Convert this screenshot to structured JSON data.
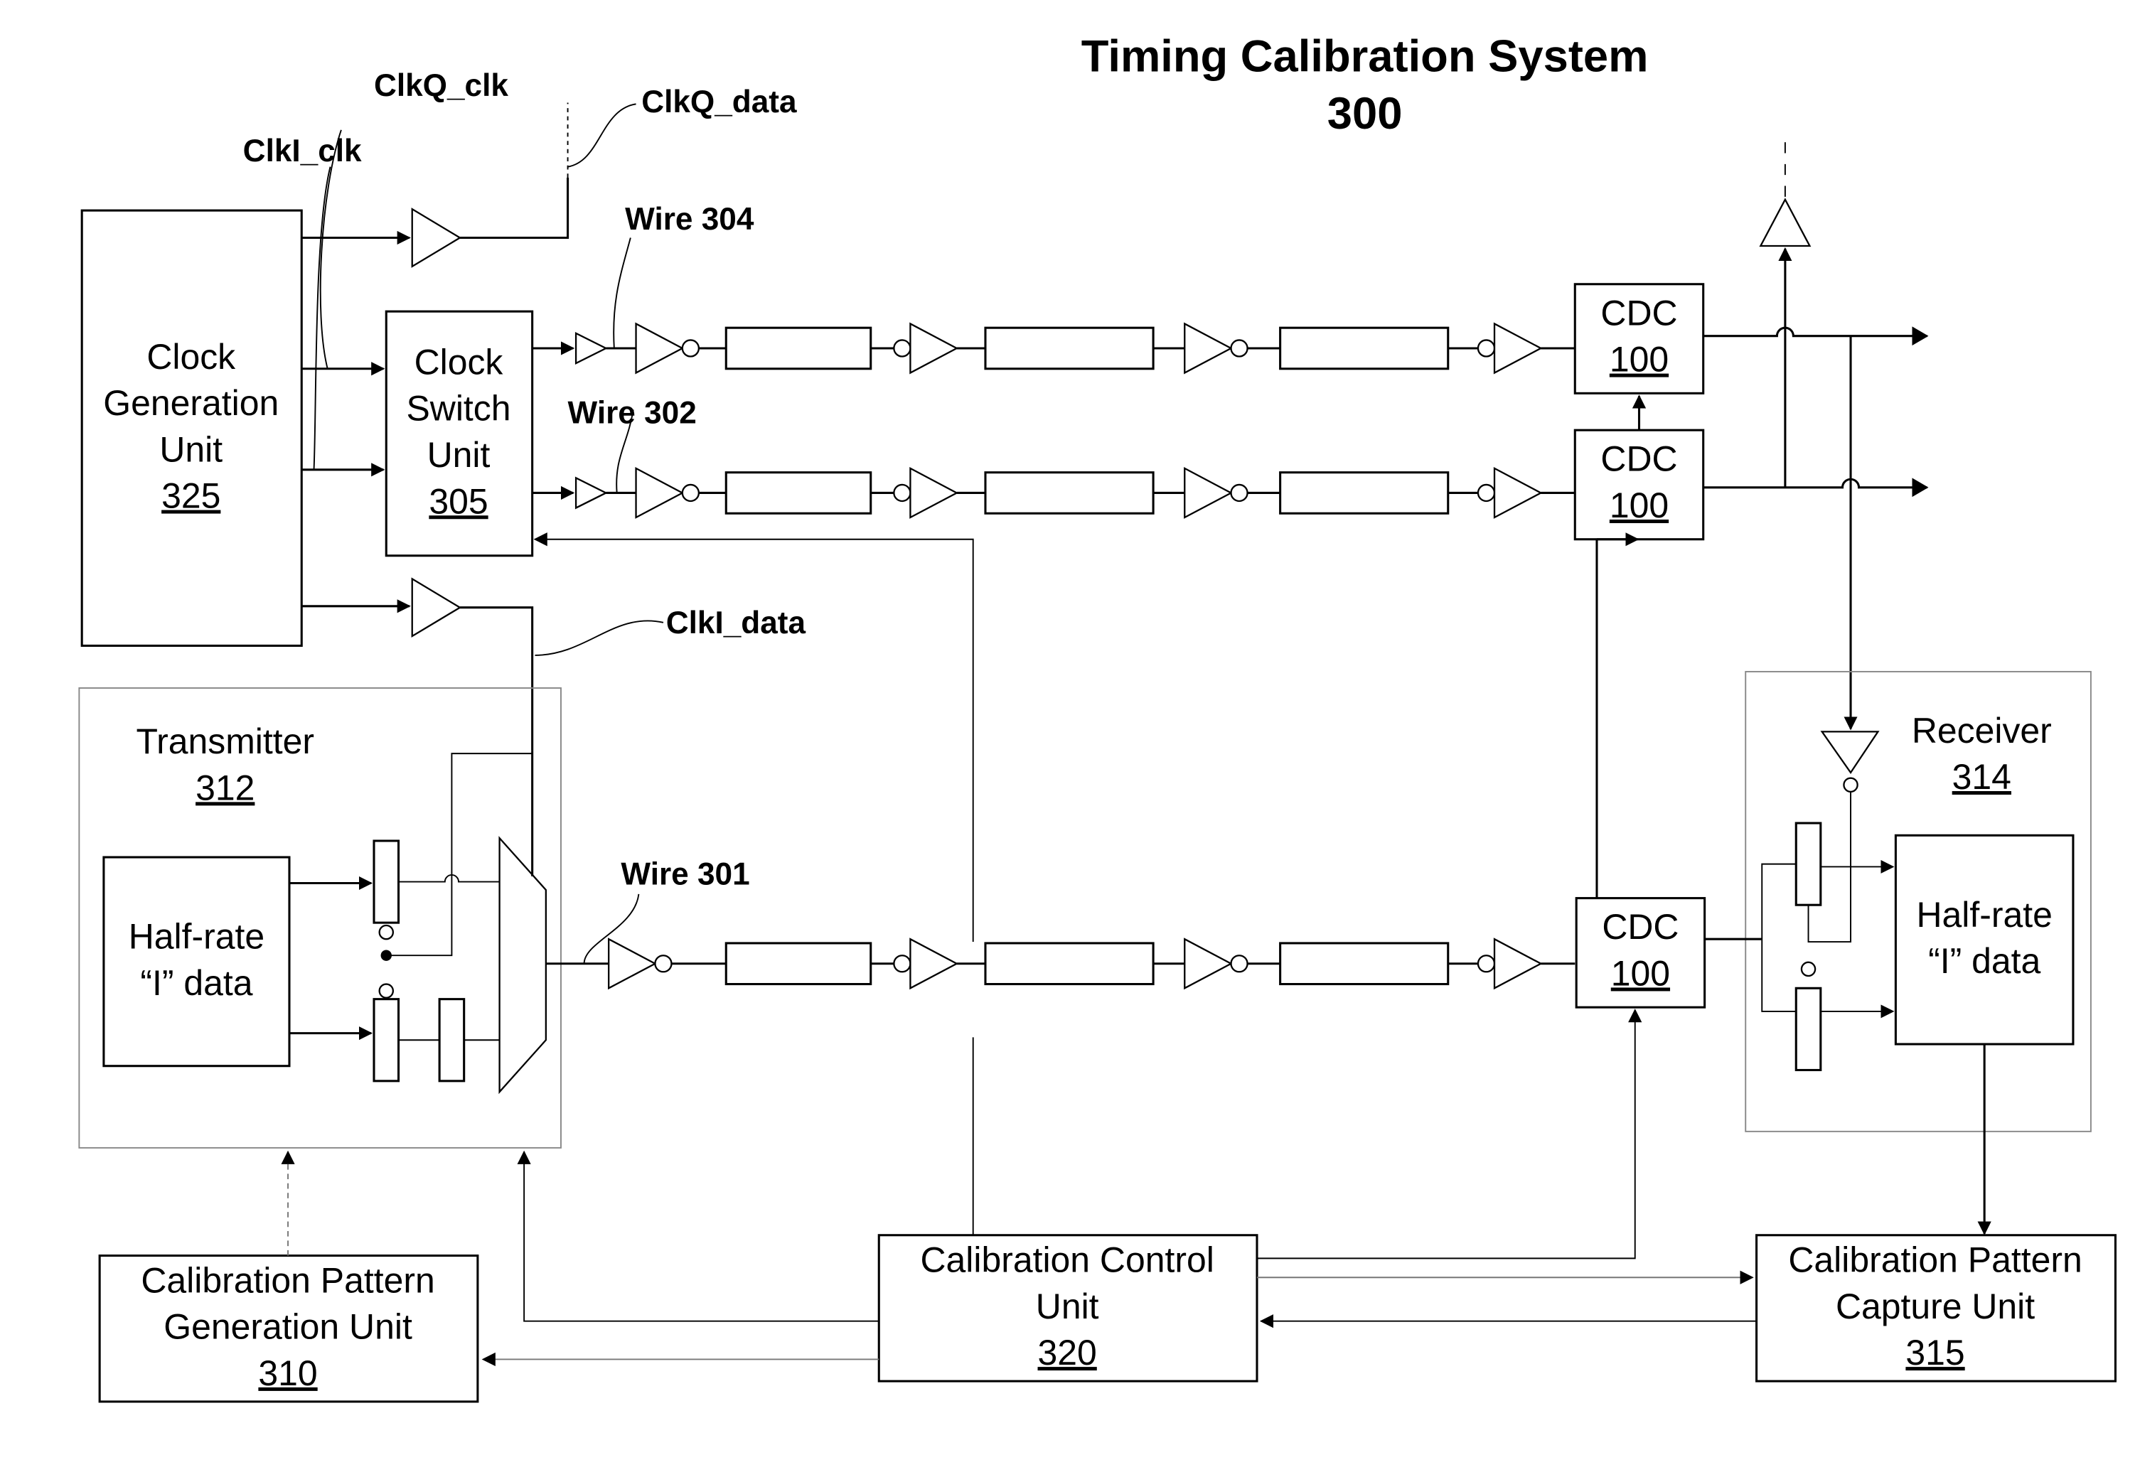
{
  "title": {
    "line1": "Timing Calibration System",
    "line2": "300"
  },
  "signals": {
    "clkq_clk": "ClkQ_clk",
    "clki_clk": "ClkI_clk",
    "clkq_data": "ClkQ_data",
    "clki_data": "ClkI_data"
  },
  "wires": {
    "w304": "Wire 304",
    "w302": "Wire 302",
    "w301": "Wire 301"
  },
  "blocks": {
    "clock_gen": {
      "lines": [
        "Clock",
        "Generation",
        "Unit"
      ],
      "ref": "325"
    },
    "clock_switch": {
      "lines": [
        "Clock",
        "Switch",
        "Unit"
      ],
      "ref": "305"
    },
    "transmitter": {
      "lines": [
        "Transmitter"
      ],
      "ref": "312"
    },
    "tx_data": {
      "lines": [
        "Half-rate",
        "“I” data"
      ]
    },
    "receiver": {
      "lines": [
        "Receiver"
      ],
      "ref": "314"
    },
    "rx_data": {
      "lines": [
        "Half-rate",
        "“I” data"
      ]
    },
    "cdc_top": {
      "lines": [
        "CDC"
      ],
      "ref": "100"
    },
    "cdc_mid": {
      "lines": [
        "CDC"
      ],
      "ref": "100"
    },
    "cdc_bot": {
      "lines": [
        "CDC"
      ],
      "ref": "100"
    },
    "cal_gen": {
      "lines": [
        "Calibration Pattern",
        "Generation Unit"
      ],
      "ref": "310"
    },
    "cal_ctrl": {
      "lines": [
        "Calibration Control",
        "Unit"
      ],
      "ref": "320"
    },
    "cal_cap": {
      "lines": [
        "Calibration Pattern",
        "Capture Unit"
      ],
      "ref": "315"
    }
  }
}
